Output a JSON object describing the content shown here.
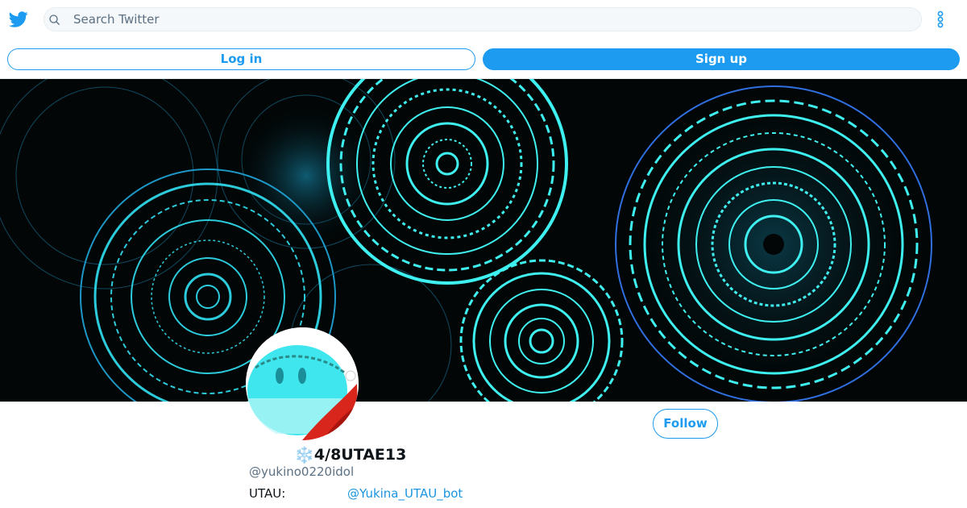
{
  "header": {
    "logo_icon": "twitter-bird-icon",
    "search": {
      "placeholder": "Search Twitter",
      "value": "",
      "icon": "search-icon"
    },
    "more_icon": "more-vertical-icon"
  },
  "auth": {
    "login_label": "Log in",
    "signup_label": "Sign up"
  },
  "profile": {
    "name_emoji": "❄️",
    "display_name": "4/8UTAE13",
    "handle": "@yukino0220idol",
    "follow_label": "Follow",
    "bio": {
      "label": "UTAU:",
      "link": "@Yukina_UTAU_bot"
    }
  },
  "colors": {
    "brand": "#1d9bf0",
    "banner_background": "#020606",
    "banner_accent": "#3ff0f0"
  }
}
